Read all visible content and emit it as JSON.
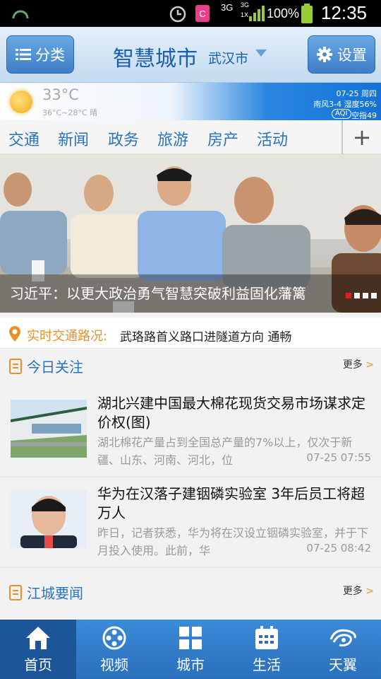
{
  "status_bar": {
    "time": "12:35",
    "battery": "100%",
    "network_1": "3G",
    "network_2": "3G",
    "network_3": "1X"
  },
  "header": {
    "category_label": "分类",
    "title": "智慧城市",
    "city": "武汉市",
    "settings_label": "设置"
  },
  "weather": {
    "temperature": "33°C",
    "range": "36°C~28°C 晴",
    "date": "07-25 周四",
    "wind_humidity": "南风3-4 湿度56%",
    "aqi_badge": "AQI",
    "air_quality": "空指49"
  },
  "tabs": [
    {
      "label": "交通"
    },
    {
      "label": "新闻"
    },
    {
      "label": "政务"
    },
    {
      "label": "旅游"
    },
    {
      "label": "房产"
    },
    {
      "label": "活动"
    }
  ],
  "tab_add": "+",
  "hero": {
    "caption": "习近平：以更大政治勇气智慧突破利益固化藩篱",
    "active_slide": 1,
    "slide_count": 4
  },
  "traffic": {
    "label": "实时交通路况:",
    "text": "武珞路首义路口进隧道方向 通畅"
  },
  "today_section": {
    "title": "今日关注",
    "more": "更多"
  },
  "news": [
    {
      "title": "湖北兴建中国最大棉花现货交易市场谋求定价权(图)",
      "summary": "湖北棉花产量占到全国总产量的7%以上，仅次于新疆、山东、河南、河北，位",
      "time": "07-25 07:55",
      "thumb_icon": "building-photo-icon"
    },
    {
      "title": "华为在汉落子建铟磷实验室 3年后员工将超万人",
      "summary": "昨日，记者获悉，华为将在汉设立铟磷实验室，并于下月投入使用。此前，华",
      "time": "07-25 08:42",
      "thumb_icon": "portrait-photo-icon"
    }
  ],
  "city_section": {
    "title": "江城要闻",
    "more": "更多"
  },
  "bottom_nav": [
    {
      "label": "首页",
      "icon": "home-icon",
      "active": true
    },
    {
      "label": "视频",
      "icon": "film-reel-icon",
      "active": false
    },
    {
      "label": "城市",
      "icon": "grid-icon",
      "active": false
    },
    {
      "label": "生活",
      "icon": "calendar-icon",
      "active": false
    },
    {
      "label": "天翼",
      "icon": "tianyi-logo-icon",
      "active": false
    }
  ],
  "colors": {
    "accent": "#2a73bd",
    "orange": "#e8902a",
    "nav_bg": "#2a70bd"
  }
}
